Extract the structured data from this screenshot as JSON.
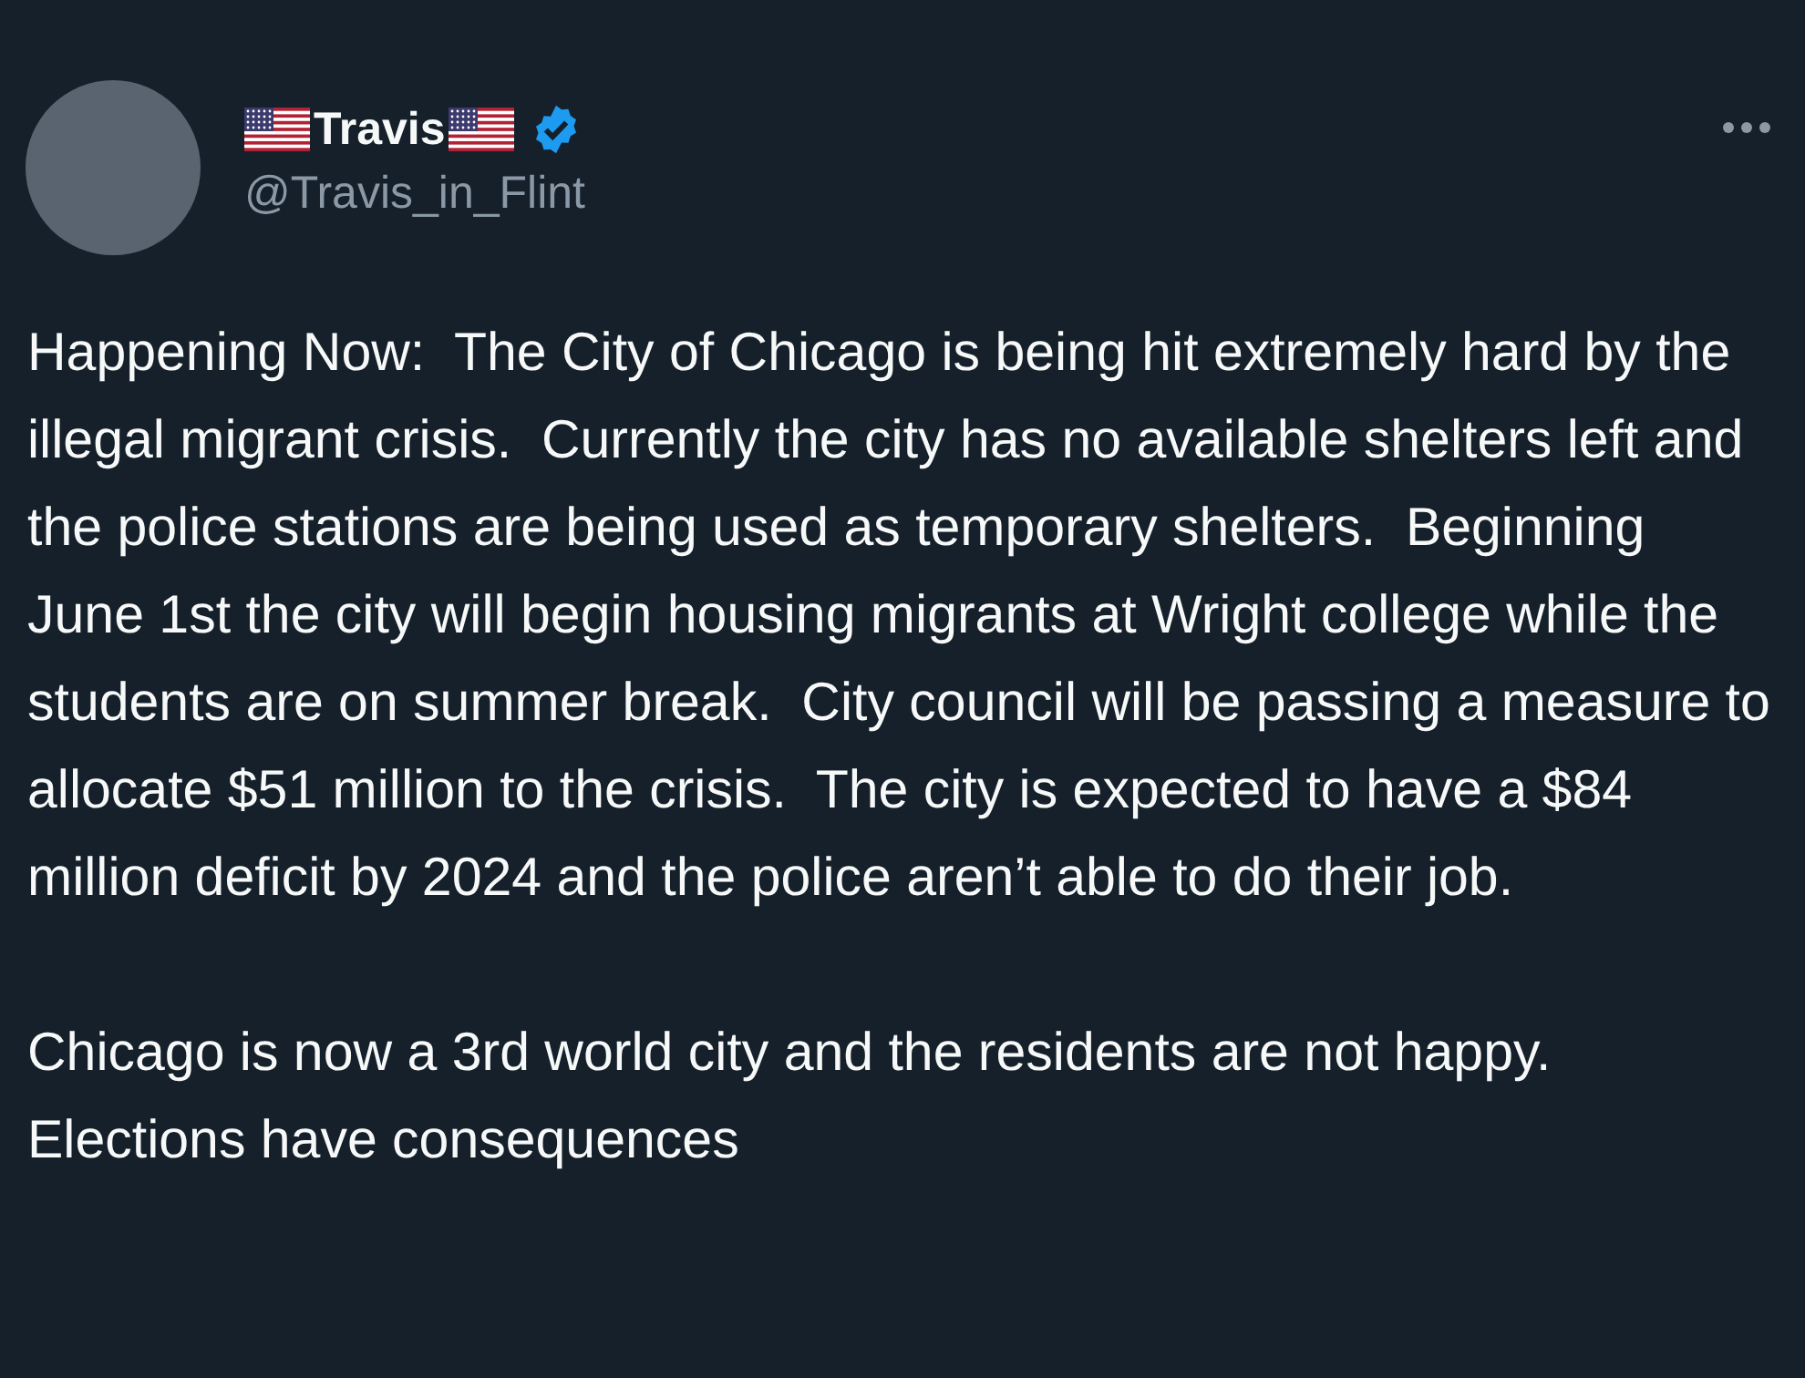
{
  "tweet": {
    "author": {
      "name": "Travis",
      "handle": "@Travis_in_Flint",
      "verified": true
    },
    "paragraphs": [
      "Happening Now:  The City of Chicago is being hit extremely hard by the illegal migrant crisis.  Currently the city has no available shelters left and the police stations are being used as temporary shelters.  Beginning June 1st the city will begin housing migrants at Wright college while the students are on summer break.  City council will be passing a measure to allocate $51 million to the crisis.  The city is expected to have a $84 million deficit by 2024 and the police aren’t able to do their job.",
      "Chicago is now a 3rd world city and the residents are not happy.  Elections have consequences"
    ]
  }
}
